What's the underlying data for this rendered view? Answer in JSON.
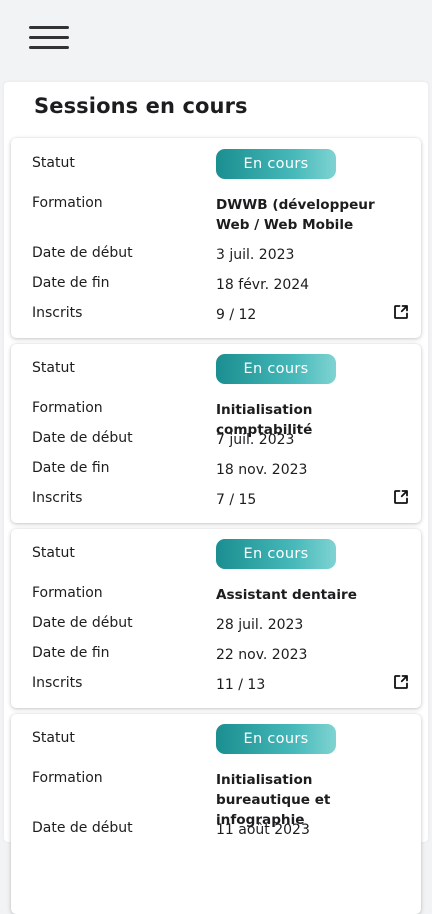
{
  "labels": {
    "statut": "Statut",
    "formation": "Formation",
    "date_debut": "Date de début",
    "date_fin": "Date de fin",
    "inscrits": "Inscrits"
  },
  "panel": {
    "title": "Sessions en cours"
  },
  "sessions": [
    {
      "statut": "En cours",
      "formation": "DWWB (développeur Web / Web Mobile",
      "date_debut": "3 juil. 2023",
      "date_fin": "18 févr. 2024",
      "inscrits": "9 / 12"
    },
    {
      "statut": "En cours",
      "formation": "Initialisation comptabilité",
      "date_debut": "7 juil. 2023",
      "date_fin": "18 nov. 2023",
      "inscrits": "7 / 15"
    },
    {
      "statut": "En cours",
      "formation": "Assistant dentaire",
      "date_debut": "28 juil. 2023",
      "date_fin": "22 nov. 2023",
      "inscrits": "11 / 13"
    },
    {
      "statut": "En cours",
      "formation": "Initialisation bureautique et infographie",
      "date_debut": "11 août 2023",
      "date_fin": "",
      "inscrits": ""
    }
  ],
  "icons": {
    "menu": "hamburger-menu-icon",
    "open": "external-link-icon"
  },
  "colors": {
    "badge_start": "#1a8e90",
    "badge_end": "#7fd3d2",
    "background": "#f2f3f5"
  }
}
